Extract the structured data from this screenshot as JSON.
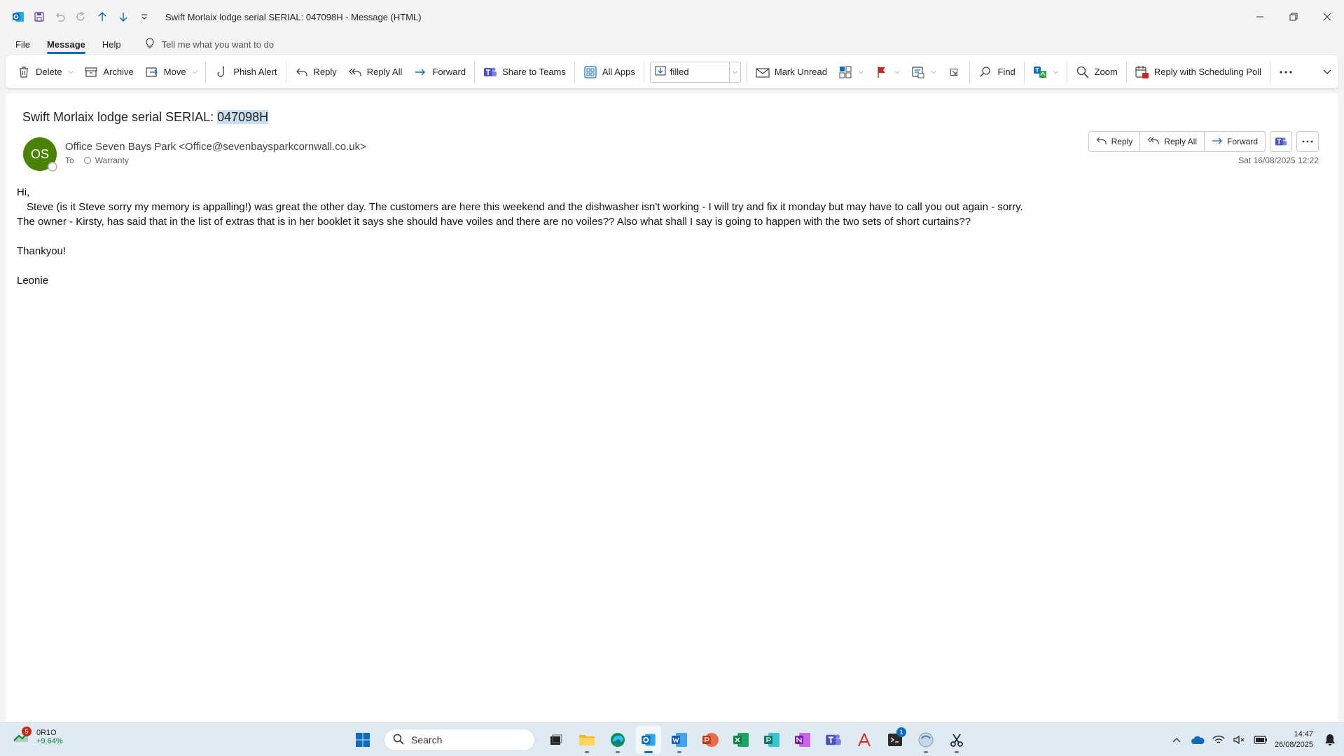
{
  "window": {
    "title": "Swift Morlaix lodge serial SERIAL: 047098H  -  Message (HTML)"
  },
  "menu": {
    "tabs": [
      "File",
      "Message",
      "Help"
    ],
    "active_tab": "Message",
    "tell_me": "Tell me what you want to do"
  },
  "ribbon": {
    "delete": "Delete",
    "archive": "Archive",
    "move": "Move",
    "phish_alert": "Phish Alert",
    "reply": "Reply",
    "reply_all": "Reply All",
    "forward": "Forward",
    "share_to_teams": "Share to Teams",
    "all_apps": "All Apps",
    "quick_step_value": "filled",
    "mark_unread": "Mark Unread",
    "find": "Find",
    "zoom": "Zoom",
    "reply_with_scheduling_poll": "Reply with Scheduling Poll"
  },
  "message": {
    "subject_prefix": "Swift Morlaix lodge serial SERIAL: ",
    "subject_highlight": "047098H",
    "avatar_initials": "OS",
    "sender": "Office Seven Bays Park <Office@sevenbaysparkcornwall.co.uk>",
    "to_label": "To",
    "to_recipient": "Warranty",
    "date": "Sat 16/08/2025 12:22",
    "actions": {
      "reply": "Reply",
      "reply_all": "Reply All",
      "forward": "Forward"
    },
    "body": [
      "Hi,",
      "Steve (is it Steve sorry my memory is appalling!) was great the other day. The customers are here this weekend and the dishwasher isn't working - I will try and fix it monday but may have to call you out again - sorry.",
      "The owner - Kirsty, has said that in the list of extras that is in her booklet it says she should have voiles and there are no voiles?? Also what shall I say is going to happen with the two sets of short curtains??",
      "",
      "Thankyou!",
      "",
      "Leonie"
    ]
  },
  "taskbar": {
    "stock_badge": "5",
    "stock_name": "0R1O",
    "stock_change": "+9.64%",
    "search_placeholder": "Search",
    "teams_badge": "1",
    "time": "14:47",
    "date": "26/08/2025"
  },
  "colors": {
    "accent": "#0f6cbd",
    "avatar": "#498205",
    "highlight": "#c9ddf3",
    "flag": "#c42b1c"
  }
}
